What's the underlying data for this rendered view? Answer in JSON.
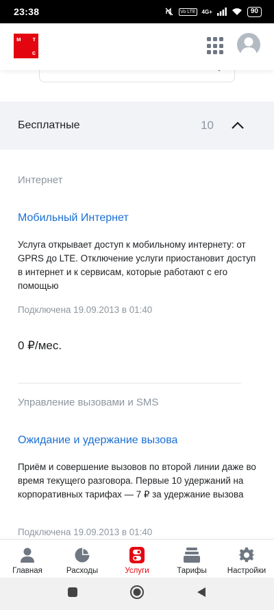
{
  "status_bar": {
    "time": "23:38",
    "network_tag": "Vo LTE",
    "network_gen": "4G+",
    "battery": "90"
  },
  "header": {
    "logo_top_left": "м",
    "logo_top_right": "т",
    "logo_bottom_right": "с",
    "icons": [
      "services-grid-icon",
      "avatar-icon"
    ]
  },
  "section": {
    "title": "Бесплатные",
    "count": "10"
  },
  "services": [
    {
      "category": "Интернет",
      "title": "Мобильный Интернет",
      "description": "Услуга открывает доступ к мобильному интернету: от GPRS до LTE. Отключение услуги приостановит доступ в интернет и к сервисам, которые работают с его помощью",
      "date": "Подключена 19.09.2013 в 01:40",
      "price": "0 ₽/мес."
    },
    {
      "category": "Управление вызовами и SMS",
      "title": "Ожидание и удержание вызова",
      "description": "Приём и совершение вызовов по второй линии даже во время текущего разговора. Первые 10 удержаний на корпоративных тарифах — 7 ₽ за удержание вызова",
      "date": "Подключена 19.09.2013 в 01:40"
    }
  ],
  "bottom_nav": {
    "items": [
      {
        "label": "Главная",
        "icon": "person-icon"
      },
      {
        "label": "Расходы",
        "icon": "pie-chart-icon"
      },
      {
        "label": "Услуги",
        "icon": "services-toggle-icon"
      },
      {
        "label": "Тарифы",
        "icon": "stack-icon"
      },
      {
        "label": "Настройки",
        "icon": "gear-icon"
      }
    ],
    "active": "Услуги"
  },
  "colors": {
    "brand_red": "#e30611",
    "link_blue": "#1a6fd4",
    "muted_gray": "#8d969f",
    "section_bg": "#f2f3f7"
  }
}
